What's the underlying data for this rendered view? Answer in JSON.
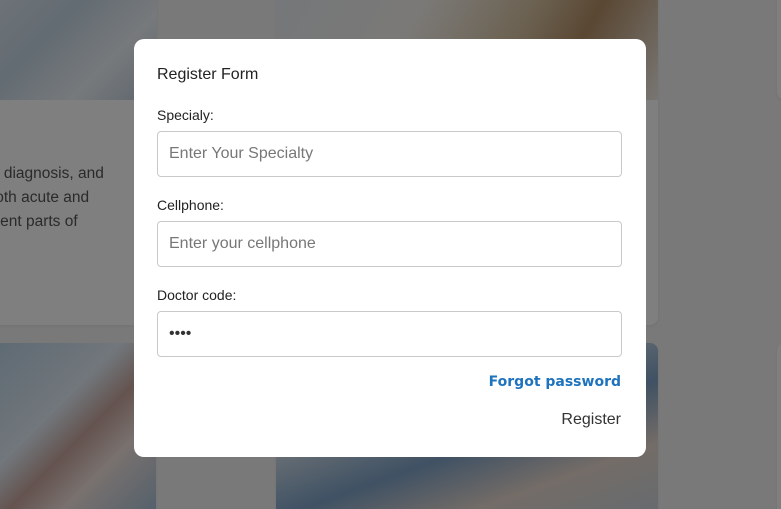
{
  "background": {
    "card_text_lines": [
      "on, diagnosis, and",
      "f both acute and",
      "fferent parts of"
    ]
  },
  "modal": {
    "title": "Register Form",
    "fields": [
      {
        "label": "Specialy:",
        "placeholder": "Enter Your Specialty",
        "value": ""
      },
      {
        "label": "Cellphone:",
        "placeholder": "Enter your cellphone",
        "value": ""
      },
      {
        "label": "Doctor code:",
        "placeholder": "",
        "value": "••••"
      }
    ],
    "forgot_password": "Forgot password",
    "register_label": "Register"
  },
  "colors": {
    "link": "#1e73be",
    "overlay": "rgba(0,0,0,0.5)"
  }
}
